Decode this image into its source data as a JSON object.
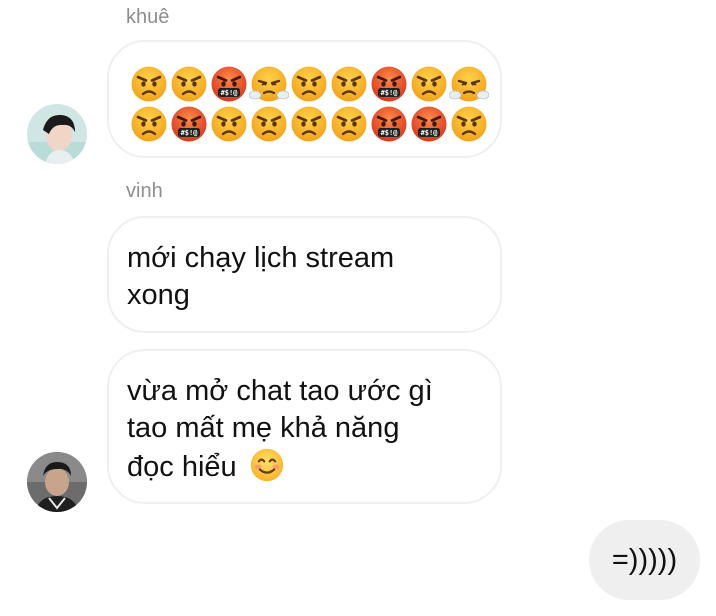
{
  "messages": {
    "khue": {
      "sender": "khuê",
      "emoji_row1": [
        "angry",
        "angry",
        "cursing",
        "steam",
        "angry",
        "angry",
        "cursing",
        "angry",
        "steam"
      ],
      "emoji_row2": [
        "angry",
        "cursing",
        "angry",
        "angry",
        "angry",
        "angry",
        "cursing",
        "cursing",
        "angry"
      ]
    },
    "vinh": {
      "sender": "vinh",
      "bubble1_line1": "mới chạy lịch stream",
      "bubble1_line2": "xong",
      "bubble2_line1": "vừa mở chat tao ước gì",
      "bubble2_line2": "tao mất mẹ khả năng",
      "bubble2_line3": "đọc hiểu",
      "bubble2_emoji": "smiling-face"
    },
    "me": {
      "text": "=)))))"
    }
  },
  "colors": {
    "sender_name": "#8e8e8e",
    "received_border": "#efefef",
    "sent_bg": "#efefef",
    "text": "#111111"
  }
}
